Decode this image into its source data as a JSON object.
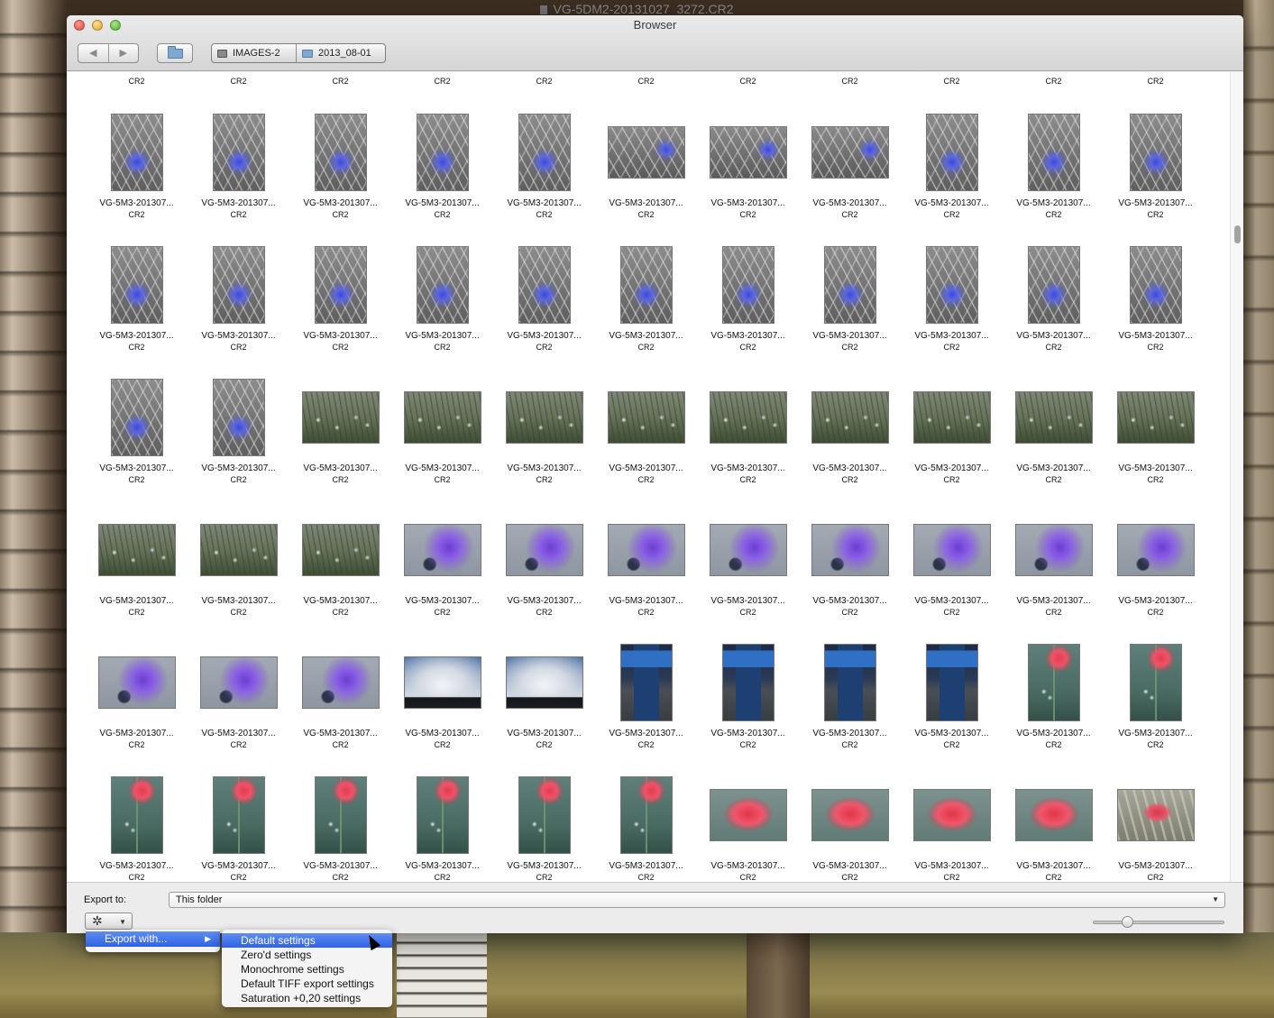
{
  "desktop": {
    "top_title": "VG-5DM2-20131027_3272.CR2"
  },
  "window": {
    "title": "Browser",
    "nav": {
      "back_icon": "◀",
      "forward_icon": "▶"
    },
    "path": [
      "IMAGES-2",
      "2013_08-01"
    ]
  },
  "grid": {
    "top_row_ext": [
      "CR2",
      "CR2",
      "CR2",
      "CR2",
      "CR2",
      "CR2",
      "CR2",
      "CR2",
      "CR2",
      "CR2",
      "CR2"
    ],
    "rows": [
      {
        "items": [
          {
            "name": "VG-5M3-201307...",
            "ext": "CR2",
            "kind": "cornflower-p"
          },
          {
            "name": "VG-5M3-201307...",
            "ext": "CR2",
            "kind": "cornflower-p"
          },
          {
            "name": "VG-5M3-201307...",
            "ext": "CR2",
            "kind": "cornflower-p"
          },
          {
            "name": "VG-5M3-201307...",
            "ext": "CR2",
            "kind": "cornflower-p"
          },
          {
            "name": "VG-5M3-201307...",
            "ext": "CR2",
            "kind": "cornflower-p"
          },
          {
            "name": "VG-5M3-201307...",
            "ext": "CR2",
            "kind": "cornflower-l"
          },
          {
            "name": "VG-5M3-201307...",
            "ext": "CR2",
            "kind": "cornflower-l"
          },
          {
            "name": "VG-5M3-201307...",
            "ext": "CR2",
            "kind": "cornflower-l"
          },
          {
            "name": "VG-5M3-201307...",
            "ext": "CR2",
            "kind": "cornflower-p"
          },
          {
            "name": "VG-5M3-201307...",
            "ext": "CR2",
            "kind": "cornflower-p"
          },
          {
            "name": "VG-5M3-201307...",
            "ext": "CR2",
            "kind": "cornflower-p"
          }
        ]
      },
      {
        "items": [
          {
            "name": "VG-5M3-201307...",
            "ext": "CR2",
            "kind": "cornflower-p"
          },
          {
            "name": "VG-5M3-201307...",
            "ext": "CR2",
            "kind": "cornflower-p"
          },
          {
            "name": "VG-5M3-201307...",
            "ext": "CR2",
            "kind": "cornflower-p"
          },
          {
            "name": "VG-5M3-201307...",
            "ext": "CR2",
            "kind": "cornflower-p"
          },
          {
            "name": "VG-5M3-201307...",
            "ext": "CR2",
            "kind": "cornflower-p"
          },
          {
            "name": "VG-5M3-201307...",
            "ext": "CR2",
            "kind": "cornflower-p"
          },
          {
            "name": "VG-5M3-201307...",
            "ext": "CR2",
            "kind": "cornflower-p"
          },
          {
            "name": "VG-5M3-201307...",
            "ext": "CR2",
            "kind": "cornflower-p"
          },
          {
            "name": "VG-5M3-201307...",
            "ext": "CR2",
            "kind": "cornflower-p"
          },
          {
            "name": "VG-5M3-201307...",
            "ext": "CR2",
            "kind": "cornflower-p"
          },
          {
            "name": "VG-5M3-201307...",
            "ext": "CR2",
            "kind": "cornflower-p"
          }
        ]
      },
      {
        "items": [
          {
            "name": "VG-5M3-201307...",
            "ext": "CR2",
            "kind": "cornflower-p"
          },
          {
            "name": "VG-5M3-201307...",
            "ext": "CR2",
            "kind": "cornflower-p"
          },
          {
            "name": "VG-5M3-201307...",
            "ext": "CR2",
            "kind": "meadow"
          },
          {
            "name": "VG-5M3-201307...",
            "ext": "CR2",
            "kind": "meadow"
          },
          {
            "name": "VG-5M3-201307...",
            "ext": "CR2",
            "kind": "meadow"
          },
          {
            "name": "VG-5M3-201307...",
            "ext": "CR2",
            "kind": "meadow"
          },
          {
            "name": "VG-5M3-201307...",
            "ext": "CR2",
            "kind": "meadow"
          },
          {
            "name": "VG-5M3-201307...",
            "ext": "CR2",
            "kind": "meadow"
          },
          {
            "name": "VG-5M3-201307...",
            "ext": "CR2",
            "kind": "meadow"
          },
          {
            "name": "VG-5M3-201307...",
            "ext": "CR2",
            "kind": "meadow"
          },
          {
            "name": "VG-5M3-201307...",
            "ext": "CR2",
            "kind": "meadow"
          }
        ]
      },
      {
        "items": [
          {
            "name": "VG-5M3-201307...",
            "ext": "CR2",
            "kind": "meadow"
          },
          {
            "name": "VG-5M3-201307...",
            "ext": "CR2",
            "kind": "meadow"
          },
          {
            "name": "VG-5M3-201307...",
            "ext": "CR2",
            "kind": "meadow"
          },
          {
            "name": "VG-5M3-201307...",
            "ext": "CR2",
            "kind": "purple"
          },
          {
            "name": "VG-5M3-201307...",
            "ext": "CR2",
            "kind": "purple"
          },
          {
            "name": "VG-5M3-201307...",
            "ext": "CR2",
            "kind": "purple"
          },
          {
            "name": "VG-5M3-201307...",
            "ext": "CR2",
            "kind": "purple"
          },
          {
            "name": "VG-5M3-201307...",
            "ext": "CR2",
            "kind": "purple"
          },
          {
            "name": "VG-5M3-201307...",
            "ext": "CR2",
            "kind": "purple"
          },
          {
            "name": "VG-5M3-201307...",
            "ext": "CR2",
            "kind": "purple"
          },
          {
            "name": "VG-5M3-201307...",
            "ext": "CR2",
            "kind": "purple"
          }
        ]
      },
      {
        "items": [
          {
            "name": "VG-5M3-201307...",
            "ext": "CR2",
            "kind": "purple"
          },
          {
            "name": "VG-5M3-201307...",
            "ext": "CR2",
            "kind": "purple"
          },
          {
            "name": "VG-5M3-201307...",
            "ext": "CR2",
            "kind": "purple"
          },
          {
            "name": "VG-5M3-201307...",
            "ext": "CR2",
            "kind": "sky"
          },
          {
            "name": "VG-5M3-201307...",
            "ext": "CR2",
            "kind": "sky"
          },
          {
            "name": "VG-5M3-201307...",
            "ext": "CR2",
            "kind": "sign"
          },
          {
            "name": "VG-5M3-201307...",
            "ext": "CR2",
            "kind": "sign"
          },
          {
            "name": "VG-5M3-201307...",
            "ext": "CR2",
            "kind": "sign"
          },
          {
            "name": "VG-5M3-201307...",
            "ext": "CR2",
            "kind": "sign"
          },
          {
            "name": "VG-5M3-201307...",
            "ext": "CR2",
            "kind": "poppy-p"
          },
          {
            "name": "VG-5M3-201307...",
            "ext": "CR2",
            "kind": "poppy-p"
          }
        ]
      },
      {
        "items": [
          {
            "name": "VG-5M3-201307...",
            "ext": "CR2",
            "kind": "poppy-p"
          },
          {
            "name": "VG-5M3-201307...",
            "ext": "CR2",
            "kind": "poppy-p"
          },
          {
            "name": "VG-5M3-201307...",
            "ext": "CR2",
            "kind": "poppy-p"
          },
          {
            "name": "VG-5M3-201307...",
            "ext": "CR2",
            "kind": "poppy-p"
          },
          {
            "name": "VG-5M3-201307...",
            "ext": "CR2",
            "kind": "poppy-p"
          },
          {
            "name": "VG-5M3-201307...",
            "ext": "CR2",
            "kind": "poppy-p"
          },
          {
            "name": "VG-5M3-201307...",
            "ext": "CR2",
            "kind": "poppy-l"
          },
          {
            "name": "VG-5M3-201307...",
            "ext": "CR2",
            "kind": "poppy-l"
          },
          {
            "name": "VG-5M3-201307...",
            "ext": "CR2",
            "kind": "poppy-l"
          },
          {
            "name": "VG-5M3-201307...",
            "ext": "CR2",
            "kind": "poppy-l"
          },
          {
            "name": "VG-5M3-201307...",
            "ext": "CR2",
            "kind": "poppy-wheat"
          }
        ]
      }
    ]
  },
  "bottom": {
    "export_label": "Export to:",
    "export_value": "This folder",
    "select_arrow": "▼",
    "gear_icon": "✲",
    "gear_caret": "▼",
    "zoom_level": 0.25
  },
  "context_menu": {
    "item": "Export with...",
    "item_arrow": "▶",
    "submenu": [
      "Default settings",
      "Zero'd settings",
      "Monochrome settings",
      "Default TIFF export settings",
      "Saturation +0,20 settings"
    ],
    "active_index": 0
  }
}
